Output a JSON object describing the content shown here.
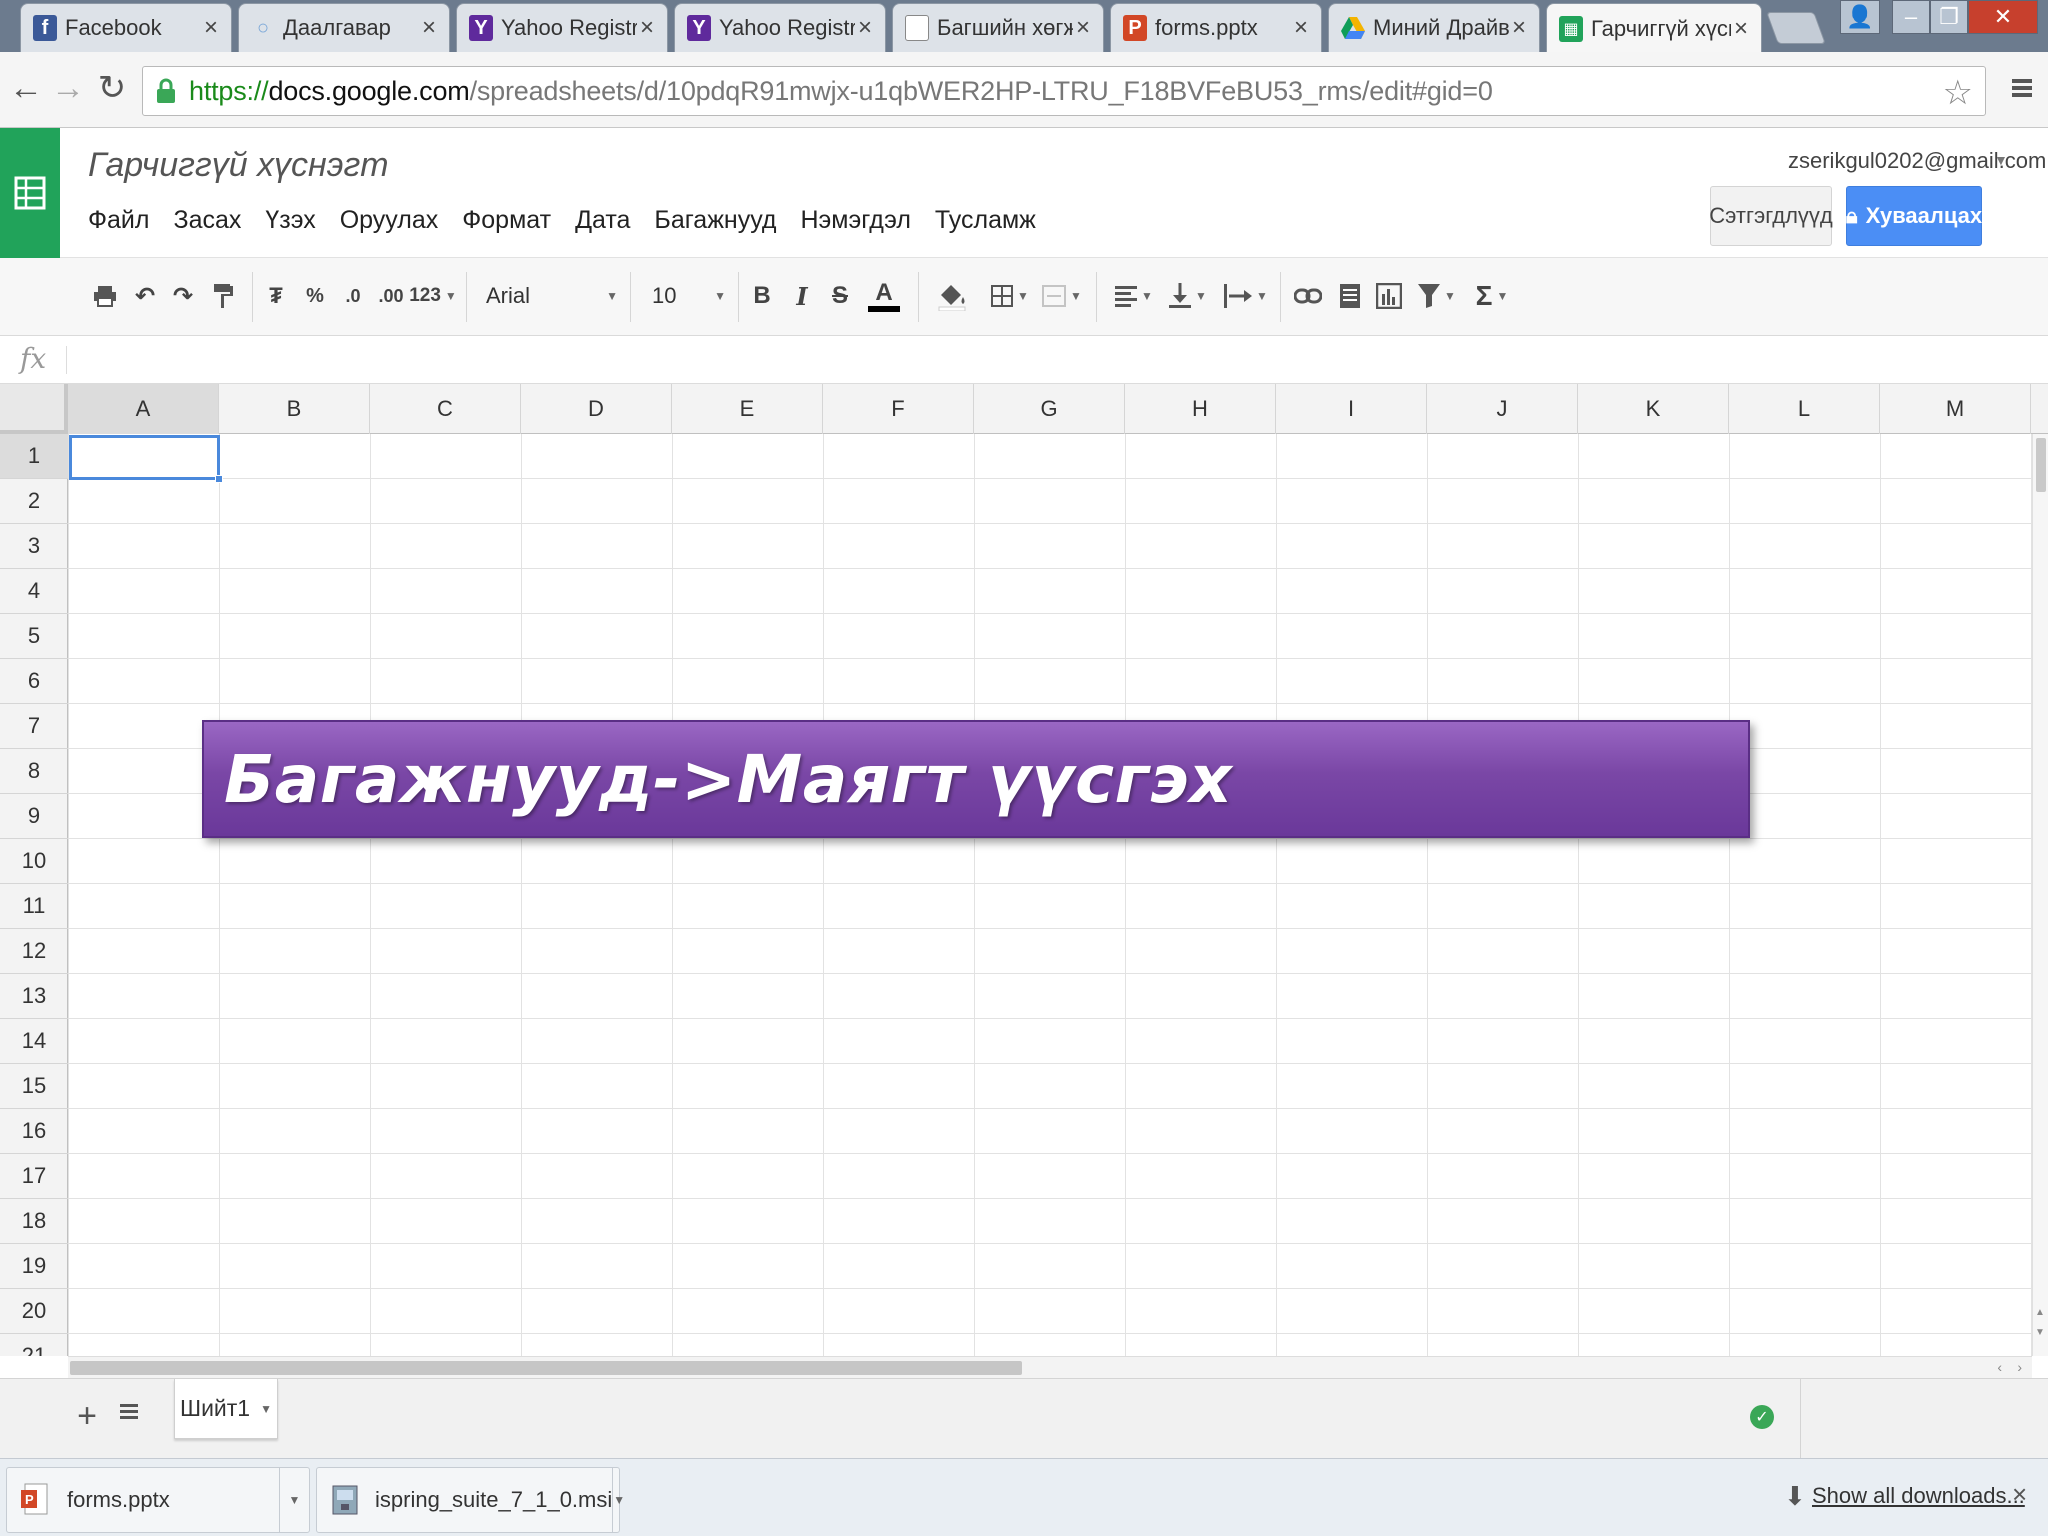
{
  "browser": {
    "tabs": [
      {
        "title": "Facebook",
        "icon": "facebook-icon",
        "color": "#3b5998",
        "glyph": "f"
      },
      {
        "title": "Даалгавар",
        "icon": "search-icon",
        "color": "#7aa7d8",
        "glyph": "◯"
      },
      {
        "title": "Yahoo Registratio",
        "icon": "yahoo-icon",
        "color": "#5f2a9c",
        "glyph": "Y"
      },
      {
        "title": "Yahoo Registratio",
        "icon": "yahoo-icon",
        "color": "#5f2a9c",
        "glyph": "Y"
      },
      {
        "title": "Багшийн хөгжил",
        "icon": "document-icon",
        "color": "#ffffff",
        "glyph": ""
      },
      {
        "title": "forms.pptx",
        "icon": "powerpoint-icon",
        "color": "#d24726",
        "glyph": "P"
      },
      {
        "title": "Миний Драйв - (",
        "icon": "google-drive-icon",
        "color": "#f4b400",
        "glyph": "▲"
      },
      {
        "title": "Гарчиггүй хүснэгт",
        "icon": "sheets-icon",
        "color": "#21a35a",
        "glyph": "▦",
        "active": true
      }
    ],
    "url": {
      "scheme": "https://",
      "host": "docs.google.com",
      "path": "/spreadsheets/d/10pdqR91mwjx-u1qbWER2HP-LTRU_F18BVFeBU53_rms/edit#gid=0"
    }
  },
  "docs": {
    "title": "Гарчиггүй хүснэгт",
    "menus": [
      "Файл",
      "Засах",
      "Үзэх",
      "Оруулах",
      "Формат",
      "Дата",
      "Багажнууд",
      "Нэмэгдэл",
      "Тусламж"
    ],
    "account_email": "zserikgul0202@gmail.com",
    "comments_label": "Сэтгэгдлүүд",
    "share_label": "Хуваалцах"
  },
  "toolbar": {
    "font": "Arial",
    "font_size": "10",
    "format_percent": "%",
    "decimal_decrease": ".0",
    "decimal_increase": ".00",
    "more_formats": "123",
    "bold": "B",
    "italic": "I",
    "strikethrough": "S",
    "text_color": "A",
    "sum": "Σ"
  },
  "formula_bar": {
    "label": "fx",
    "value": ""
  },
  "grid": {
    "columns": [
      "A",
      "B",
      "C",
      "D",
      "E",
      "F",
      "G",
      "H",
      "I",
      "J",
      "K",
      "L",
      "M"
    ],
    "rows": [
      "1",
      "2",
      "3",
      "4",
      "5",
      "6",
      "7",
      "8",
      "9",
      "10",
      "11",
      "12",
      "13",
      "14",
      "15",
      "16",
      "17",
      "18",
      "19",
      "20",
      "21"
    ],
    "active_cell": "A1"
  },
  "overlay": {
    "text": "Багажнууд->Маягт үүсгэх",
    "color": "#7a47a6"
  },
  "sheets": {
    "tab_name": "Шийт1"
  },
  "downloads": {
    "items": [
      {
        "name": "forms.pptx",
        "icon": "powerpoint-icon"
      },
      {
        "name": "ispring_suite_7_1_0.msi",
        "icon": "installer-icon"
      }
    ],
    "show_all_label": "Show all downloads..."
  },
  "colors": {
    "accent": "#4b8ef5",
    "sheets_green": "#21a35a",
    "banner_purple": "#7a47a6"
  }
}
